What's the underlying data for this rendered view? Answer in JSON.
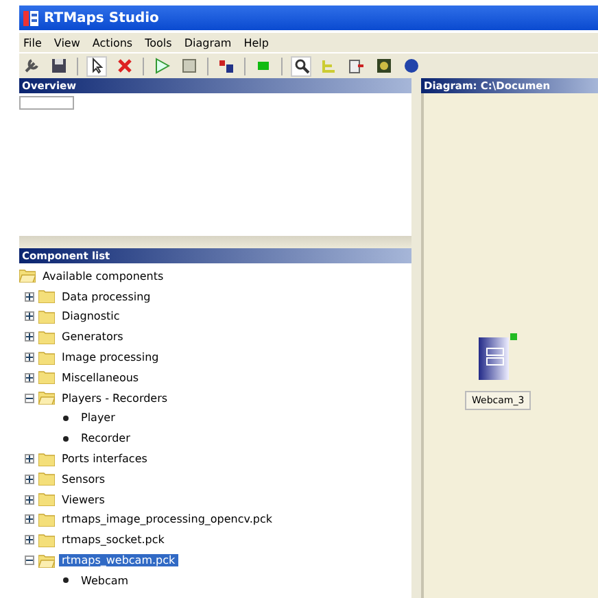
{
  "window": {
    "title": "RTMaps Studio"
  },
  "menu": [
    "File",
    "View",
    "Actions",
    "Tools",
    "Diagram",
    "Help"
  ],
  "overview": {
    "title": "Overview"
  },
  "component_list": {
    "title": "Component list",
    "tree": [
      {
        "label": "Available components",
        "kind": "folder",
        "expanded": true,
        "selected": false,
        "children": [
          {
            "label": "Data processing",
            "kind": "folder",
            "expanded": false,
            "selected": false
          },
          {
            "label": "Diagnostic",
            "kind": "folder",
            "expanded": false,
            "selected": false
          },
          {
            "label": "Generators",
            "kind": "folder",
            "expanded": false,
            "selected": false
          },
          {
            "label": "Image processing",
            "kind": "folder",
            "expanded": false,
            "selected": false
          },
          {
            "label": "Miscellaneous",
            "kind": "folder",
            "expanded": false,
            "selected": false
          },
          {
            "label": "Players - Recorders",
            "kind": "folder",
            "expanded": true,
            "selected": false,
            "children": [
              {
                "label": "Player",
                "kind": "component",
                "selected": false
              },
              {
                "label": "Recorder",
                "kind": "component",
                "selected": false
              }
            ]
          },
          {
            "label": "Ports interfaces",
            "kind": "folder",
            "expanded": false,
            "selected": false
          },
          {
            "label": "Sensors",
            "kind": "folder",
            "expanded": false,
            "selected": false
          },
          {
            "label": "Viewers",
            "kind": "folder",
            "expanded": false,
            "selected": false
          },
          {
            "label": "rtmaps_image_processing_opencv.pck",
            "kind": "folder",
            "expanded": false,
            "selected": false
          },
          {
            "label": "rtmaps_socket.pck",
            "kind": "folder",
            "expanded": false,
            "selected": false
          },
          {
            "label": "rtmaps_webcam.pck",
            "kind": "folder",
            "expanded": true,
            "selected": true,
            "children": [
              {
                "label": "Webcam",
                "kind": "component",
                "selected": false
              }
            ]
          }
        ]
      }
    ]
  },
  "diagram": {
    "title": "Diagram: C:\\Documen",
    "components": [
      {
        "label": "Webcam_3"
      }
    ]
  }
}
